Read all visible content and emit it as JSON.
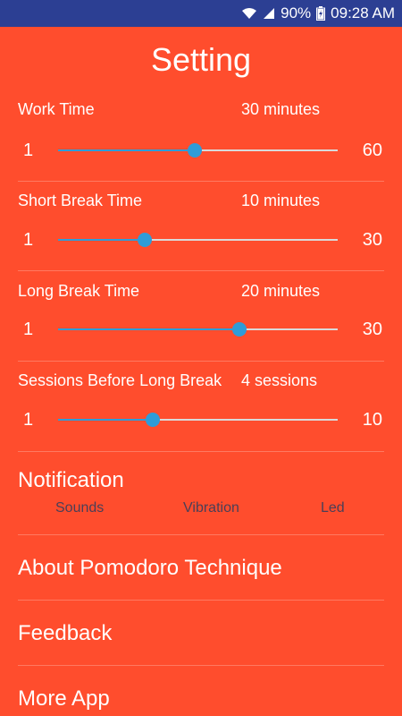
{
  "status_bar": {
    "battery_percent": "90%",
    "time": "09:28 AM",
    "icons": [
      "wifi-icon",
      "signal-icon",
      "battery-icon"
    ]
  },
  "title": "Setting",
  "settings": [
    {
      "label": "Work Time",
      "value": "30 minutes",
      "min": "1",
      "max": "60",
      "fraction": 0.49
    },
    {
      "label": "Short Break Time",
      "value": "10 minutes",
      "min": "1",
      "max": "30",
      "fraction": 0.31
    },
    {
      "label": "Long Break Time",
      "value": "20 minutes",
      "min": "1",
      "max": "30",
      "fraction": 0.65
    },
    {
      "label": "Sessions Before Long Break",
      "value": "4 sessions",
      "min": "1",
      "max": "10",
      "fraction": 0.34
    }
  ],
  "notification": {
    "title": "Notification",
    "options": [
      "Sounds",
      "Vibration",
      "Led"
    ]
  },
  "menu": [
    {
      "label": "About Pomodoro Technique"
    },
    {
      "label": "Feedback"
    },
    {
      "label": "More App"
    }
  ],
  "colors": {
    "background": "#ff4d2d",
    "status_bar": "#2c3f93",
    "accent": "#2f9cd8",
    "track": "#d9d9d9"
  }
}
